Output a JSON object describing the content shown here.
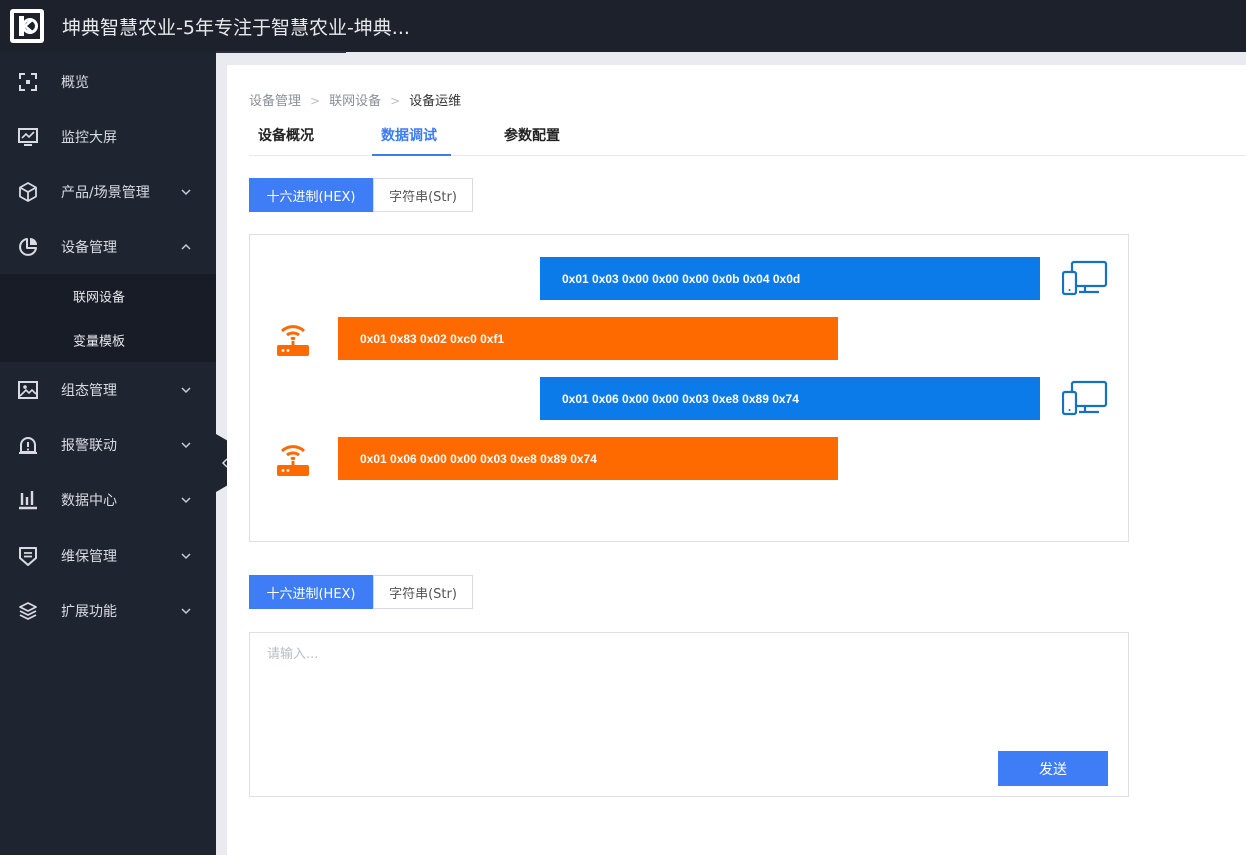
{
  "app": {
    "title": "坤典智慧农业-5年专注于智慧农业-坤典..."
  },
  "sidebar": {
    "items": [
      {
        "label": "概览",
        "icon": "overview-icon",
        "arrow": ""
      },
      {
        "label": "监控大屏",
        "icon": "monitor-icon",
        "arrow": ""
      },
      {
        "label": "产品/场景管理",
        "icon": "cube-icon",
        "arrow": "chevron-down"
      },
      {
        "label": "设备管理",
        "icon": "pie-chart-icon",
        "arrow": "chevron-up"
      },
      {
        "label": "组态管理",
        "icon": "image-icon",
        "arrow": "chevron-down"
      },
      {
        "label": "报警联动",
        "icon": "alarm-icon",
        "arrow": "chevron-down"
      },
      {
        "label": "数据中心",
        "icon": "bar-chart-icon",
        "arrow": "chevron-down"
      },
      {
        "label": "维保管理",
        "icon": "maintenance-icon",
        "arrow": "chevron-down"
      },
      {
        "label": "扩展功能",
        "icon": "layers-icon",
        "arrow": "chevron-down"
      }
    ],
    "submenu": [
      {
        "label": "联网设备"
      },
      {
        "label": "变量模板"
      }
    ]
  },
  "breadcrumb": {
    "items": [
      "设备管理",
      "联网设备",
      "设备运维"
    ],
    "separator": ">"
  },
  "tabs": [
    {
      "label": "设备概况",
      "active": false
    },
    {
      "label": "数据调试",
      "active": true
    },
    {
      "label": "参数配置",
      "active": false
    }
  ],
  "format_toggle_top": {
    "hex_label": "十六进制(HEX)",
    "str_label": "字符串(Str)",
    "selected": "hex"
  },
  "messages": [
    {
      "direction": "sent",
      "text": "0x01 0x03 0x00 0x00 0x00 0x0b 0x04 0x0d"
    },
    {
      "direction": "received",
      "text": "0x01 0x83 0x02 0xc0 0xf1"
    },
    {
      "direction": "sent",
      "text": "0x01 0x06 0x00 0x00 0x03 0xe8 0x89 0x74"
    },
    {
      "direction": "received",
      "text": "0x01 0x06 0x00 0x00 0x03 0xe8 0x89 0x74"
    }
  ],
  "format_toggle_bottom": {
    "hex_label": "十六进制(HEX)",
    "str_label": "字符串(Str)",
    "selected": "hex"
  },
  "send_input": {
    "value": "",
    "placeholder": "请输入..."
  },
  "send_button": {
    "label": "发送"
  },
  "colors": {
    "accent": "#3f7df6",
    "sent_bubble": "#0a7be8",
    "received_bubble": "#ff6a00",
    "sidebar_bg": "#1f2431",
    "topbar_bg": "#1d212b"
  }
}
